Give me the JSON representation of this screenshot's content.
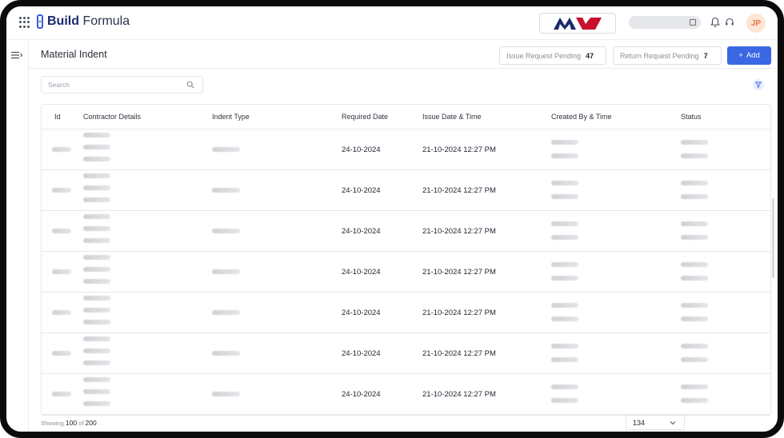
{
  "app": {
    "brand_bold": "Build",
    "brand_light": "Formula",
    "avatar_initials": "JP"
  },
  "page": {
    "title": "Material Indent"
  },
  "header_buttons": {
    "issue_label": "Issue Request Pending",
    "issue_count": "47",
    "return_label": "Return Request Pending",
    "return_count": "7",
    "add_label": "Add"
  },
  "search": {
    "placeholder": "Search"
  },
  "table": {
    "columns": [
      "Id",
      "Contractor Details",
      "Indent Type",
      "Required Date",
      "Issue Date & Time",
      "Created By & Time",
      "Status"
    ],
    "rows": [
      {
        "required_date": "24-10-2024",
        "issue_datetime": "21-10-2024 12:27 PM"
      },
      {
        "required_date": "24-10-2024",
        "issue_datetime": "21-10-2024 12:27 PM"
      },
      {
        "required_date": "24-10-2024",
        "issue_datetime": "21-10-2024 12:27 PM"
      },
      {
        "required_date": "24-10-2024",
        "issue_datetime": "21-10-2024 12:27 PM"
      },
      {
        "required_date": "24-10-2024",
        "issue_datetime": "21-10-2024 12:27 PM"
      },
      {
        "required_date": "24-10-2024",
        "issue_datetime": "21-10-2024 12:27 PM"
      },
      {
        "required_date": "24-10-2024",
        "issue_datetime": "21-10-2024 12:27 PM"
      }
    ]
  },
  "footer": {
    "showing_label": "Showing",
    "shown": "100",
    "of_label": "of",
    "total": "200",
    "page_select": "134"
  },
  "colors": {
    "accent": "#3a68e4",
    "avatar_bg": "#fde6d6",
    "avatar_text": "#e07b3f",
    "brand_red": "#c8102e",
    "brand_navy": "#1a2a6c"
  },
  "icons": [
    "apps-grid-icon",
    "bell-icon",
    "headset-icon",
    "menu-icon",
    "search-icon",
    "filter-icon",
    "chevron-down-icon",
    "plus-icon"
  ]
}
